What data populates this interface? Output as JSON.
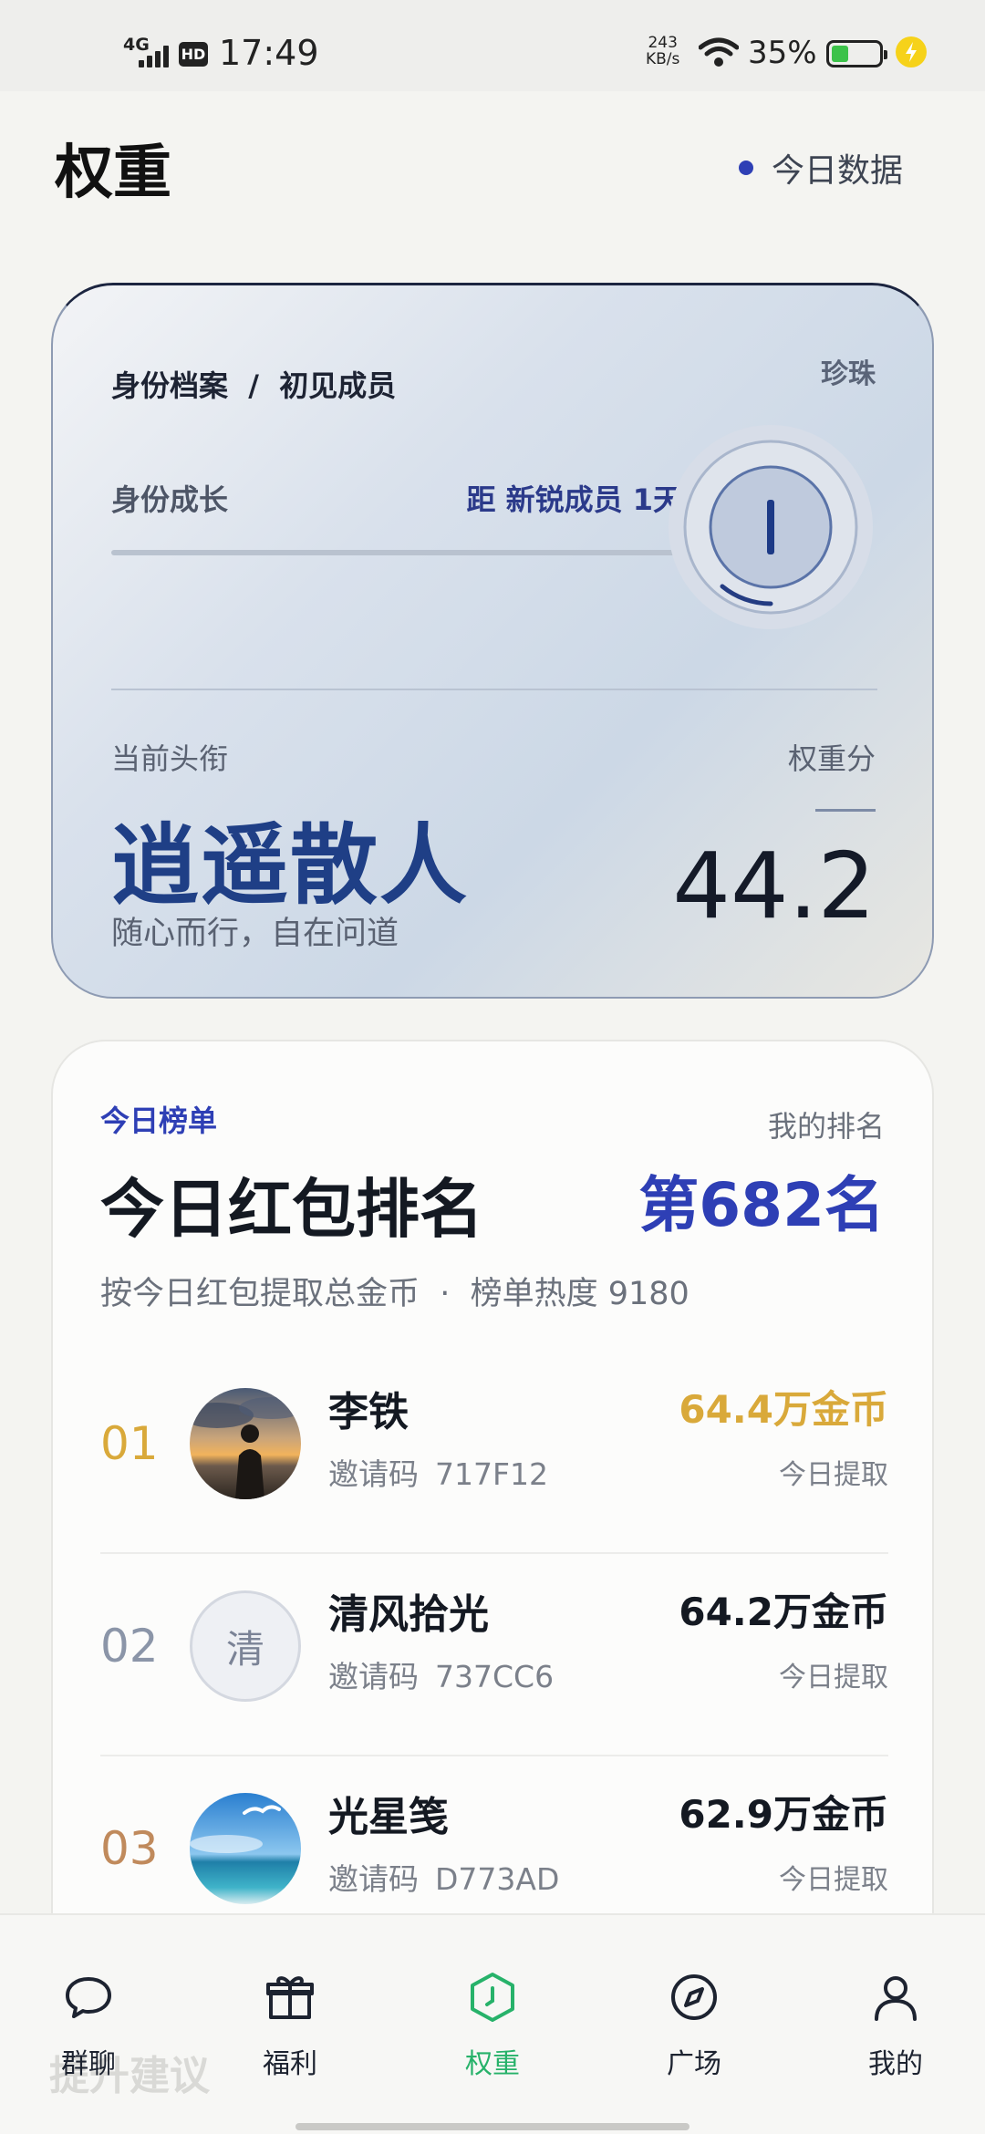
{
  "status_bar": {
    "network": "4G",
    "hd": "HD",
    "time": "17:49",
    "speed_value": "243",
    "speed_unit": "KB/s",
    "battery": "35%",
    "battery_level": 0.35,
    "icons": [
      "signal-icon",
      "wifi-icon",
      "battery-icon",
      "charging-icon"
    ]
  },
  "header": {
    "title": "权重",
    "today_data_label": "今日数据",
    "accent": "#2e3fb5"
  },
  "identity": {
    "breadcrumb": "身份档案  /  初见成员",
    "level_name": "珍珠",
    "growth_label": "身份成长",
    "growth_target": "距 新锐成员 1天",
    "growth_progress": 0,
    "badge_icon": "level-badge-icon",
    "title_label": "当前头衔",
    "title": "逍遥散人",
    "title_sub": "随心而行，自在问道",
    "score_label": "权重分",
    "score": "44.2"
  },
  "ranking": {
    "tag": "今日榜单",
    "my_rank_label": "我的排名",
    "title": "今日红包排名",
    "my_rank": "第682名",
    "subtitle": "按今日红包提取总金币  ·  榜单热度 9180",
    "invite_label": "邀请码",
    "rows": [
      {
        "rank": "01",
        "name": "李铁",
        "code": "717F12",
        "amount": "64.4万金币",
        "when": "今日提取",
        "rank_color": "#d9a93a",
        "amount_color": "#d9a93a",
        "avatar": "sunset-photo"
      },
      {
        "rank": "02",
        "name": "清风拾光",
        "code": "737CC6",
        "amount": "64.2万金币",
        "when": "今日提取",
        "rank_color": "#8b95a8",
        "amount_color": "#141922",
        "avatar_text": "清"
      },
      {
        "rank": "03",
        "name": "光星笺",
        "code": "D773AD",
        "amount": "62.9万金币",
        "when": "今日提取",
        "rank_color": "#c08a5c",
        "amount_color": "#141922",
        "avatar": "sea-photo"
      }
    ]
  },
  "bottom_hint": "提升建议",
  "nav": {
    "items": [
      {
        "label": "群聊",
        "icon": "chat-icon"
      },
      {
        "label": "福利",
        "icon": "gift-icon"
      },
      {
        "label": "权重",
        "icon": "weight-icon",
        "active": true
      },
      {
        "label": "广场",
        "icon": "compass-icon"
      },
      {
        "label": "我的",
        "icon": "profile-icon"
      }
    ],
    "active_color": "#27b26a"
  }
}
